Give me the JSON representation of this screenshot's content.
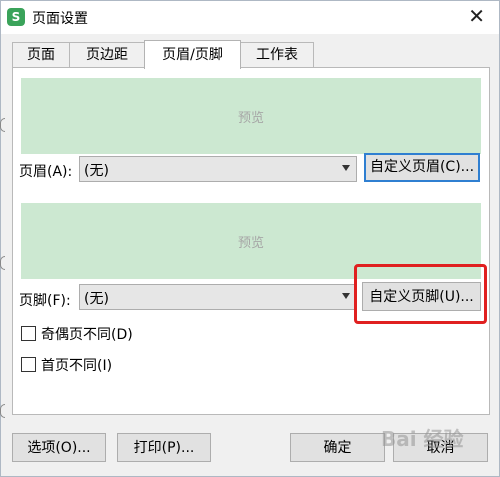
{
  "window": {
    "title": "页面设置",
    "app_icon_letter": "S"
  },
  "tabs": [
    {
      "label": "页面",
      "active": false
    },
    {
      "label": "页边距",
      "active": false
    },
    {
      "label": "页眉/页脚",
      "active": true
    },
    {
      "label": "工作表",
      "active": false
    }
  ],
  "header": {
    "preview_label": "预览",
    "field_label": "页眉(A):",
    "value": "(无)",
    "custom_button": "自定义页眉(C)..."
  },
  "footer": {
    "preview_label": "预览",
    "field_label": "页脚(F):",
    "value": "(无)",
    "custom_button": "自定义页脚(U)..."
  },
  "options": {
    "odd_even": {
      "label": "奇偶页不同(D)",
      "checked": false
    },
    "first_page": {
      "label": "首页不同(I)",
      "checked": false
    }
  },
  "buttons": {
    "options": "选项(O)...",
    "print": "打印(P)...",
    "ok": "确定",
    "cancel": "取消"
  },
  "watermark": "Bai 经验",
  "colors": {
    "preview_bg": "#cce8d1",
    "highlight": "#e02020",
    "focus": "#2f7fd1"
  }
}
